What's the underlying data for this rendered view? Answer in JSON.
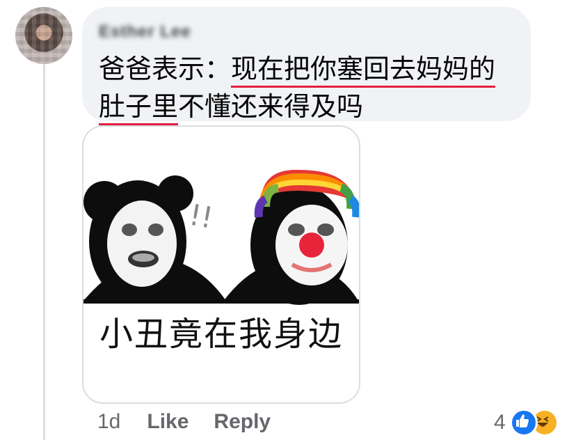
{
  "comment": {
    "author_name": "Esther Lee",
    "text_part1": "爸爸表示：",
    "text_highlight1": "现在把你塞回去妈妈的",
    "text_highlight2": "肚子里",
    "text_part2": "不懂还来得及吗"
  },
  "sticker": {
    "caption": "小丑竟在我身边",
    "exclaim": "!!"
  },
  "actions": {
    "time": "1d",
    "like_label": "Like",
    "reply_label": "Reply"
  },
  "reactions": {
    "count": "4",
    "types": [
      "like-icon",
      "haha-icon"
    ],
    "like_color": "#1877f2",
    "haha_color": "#f7b125"
  },
  "colors": {
    "bubble": "#f0f2f5",
    "underline": "#e41e3f",
    "meta_text": "#65676b"
  }
}
